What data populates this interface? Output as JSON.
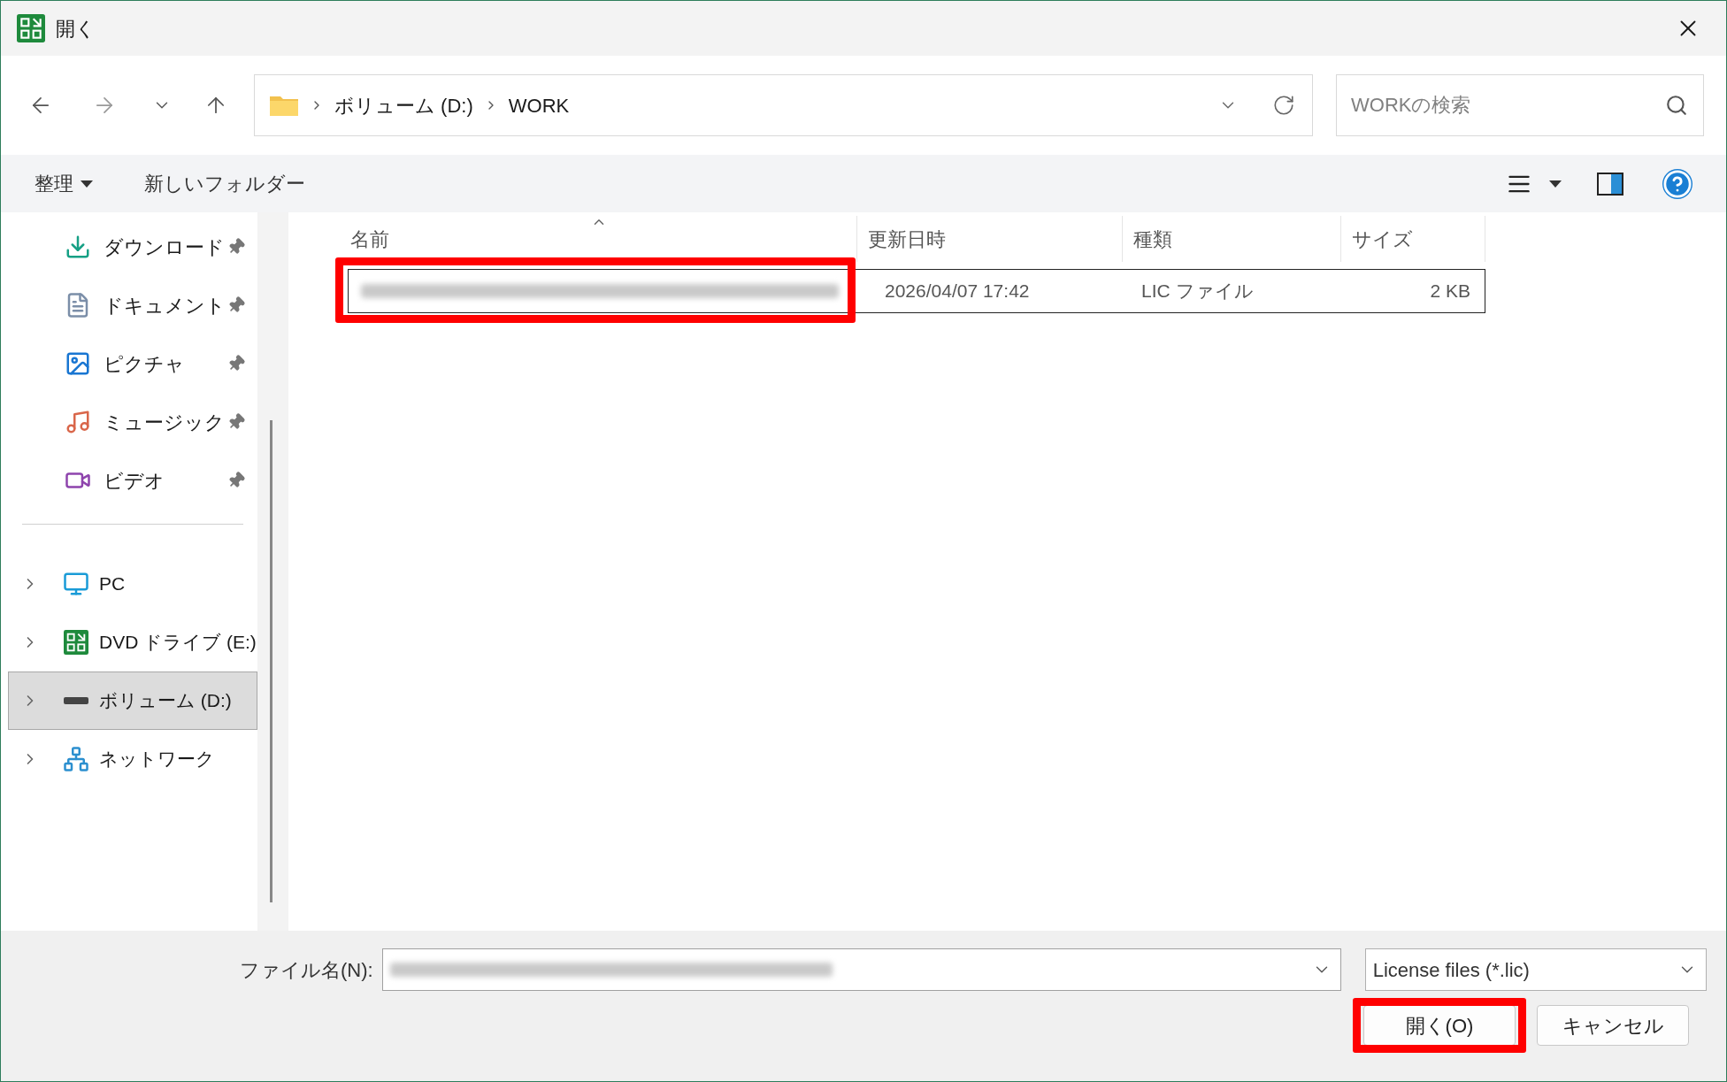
{
  "window": {
    "title": "開く"
  },
  "address": {
    "crumbs": [
      "ボリューム (D:)",
      "WORK"
    ]
  },
  "search": {
    "placeholder": "WORKの検索"
  },
  "toolbar": {
    "organize": "整理",
    "new_folder": "新しいフォルダー"
  },
  "sidebar": {
    "quick_access": [
      {
        "label": "ダウンロード",
        "kind": "download",
        "pinned": true
      },
      {
        "label": "ドキュメント",
        "kind": "document",
        "pinned": true
      },
      {
        "label": "ピクチャ",
        "kind": "picture",
        "pinned": true
      },
      {
        "label": "ミュージック",
        "kind": "music",
        "pinned": true
      },
      {
        "label": "ビデオ",
        "kind": "video",
        "pinned": true
      }
    ],
    "locations": [
      {
        "label": "PC",
        "kind": "pc",
        "selected": false
      },
      {
        "label": "DVD ドライブ (E:)",
        "kind": "dvd",
        "selected": false
      },
      {
        "label": "ボリューム (D:)",
        "kind": "drive",
        "selected": true
      },
      {
        "label": "ネットワーク",
        "kind": "network",
        "selected": false
      }
    ]
  },
  "columns": [
    "名前",
    "更新日時",
    "種類",
    "サイズ"
  ],
  "rows": [
    {
      "name": {
        "kind": "blurred"
      },
      "highlighted": true,
      "focused": true,
      "modified": "2026/04/07 17:42",
      "type": "LIC ファイル",
      "size": "2 KB"
    }
  ],
  "footer": {
    "filename_label": "ファイル名(N):",
    "filename": {
      "kind": "blurred"
    },
    "filter": "License files (*.lic)",
    "buttons": [
      {
        "label": "開く(O)",
        "highlighted": true
      },
      {
        "label": "キャンセル",
        "highlighted": false
      }
    ]
  }
}
